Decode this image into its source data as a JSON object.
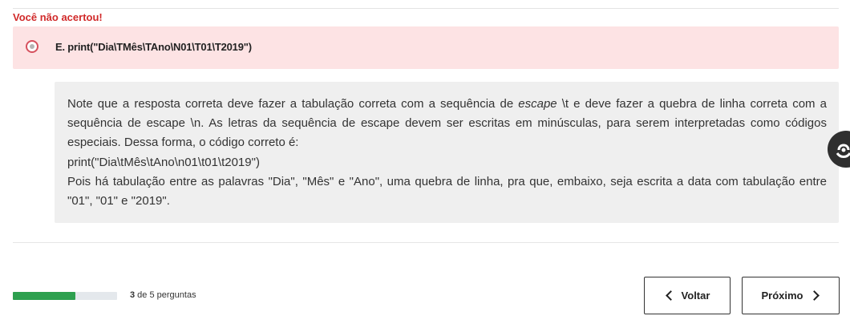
{
  "result": {
    "title": "Você não acertou!"
  },
  "answer": {
    "text": "E. print(\"Dia\\TMês\\TAno\\N01\\T01\\T2019\")"
  },
  "feedback": {
    "line1_before": "Note que a resposta correta deve fazer a tabulação correta com a sequência de ",
    "line1_em": "escape",
    "line1_after": " \\t e deve fazer a quebra de linha correta com a sequência de escape \\n. As letras da sequência de escape devem ser escritas em minúsculas, para serem interpretadas como códigos especiais. Dessa forma, o código correto é:",
    "code": "print(\"Dia\\tMês\\tAno\\n01\\t01\\t2019\")",
    "explanation": "Pois há tabulação entre as palavras \"Dia\", \"Mês\" e \"Ano\", uma quebra de linha, pra que, embaixo, seja escrita a data com tabulação entre \"01\", \"01\" e \"2019\"."
  },
  "progress": {
    "current": "3",
    "suffix": " de 5 perguntas",
    "fraction": 0.6,
    "fill_color": "#2ea04f"
  },
  "nav": {
    "back_label": "Voltar",
    "next_label": "Próximo"
  },
  "colors": {
    "error": "#d12a2a",
    "answer_bg": "#fde3e4",
    "feedback_bg": "#efefef"
  },
  "icons": {
    "side_badge": "accessibility-icon"
  }
}
